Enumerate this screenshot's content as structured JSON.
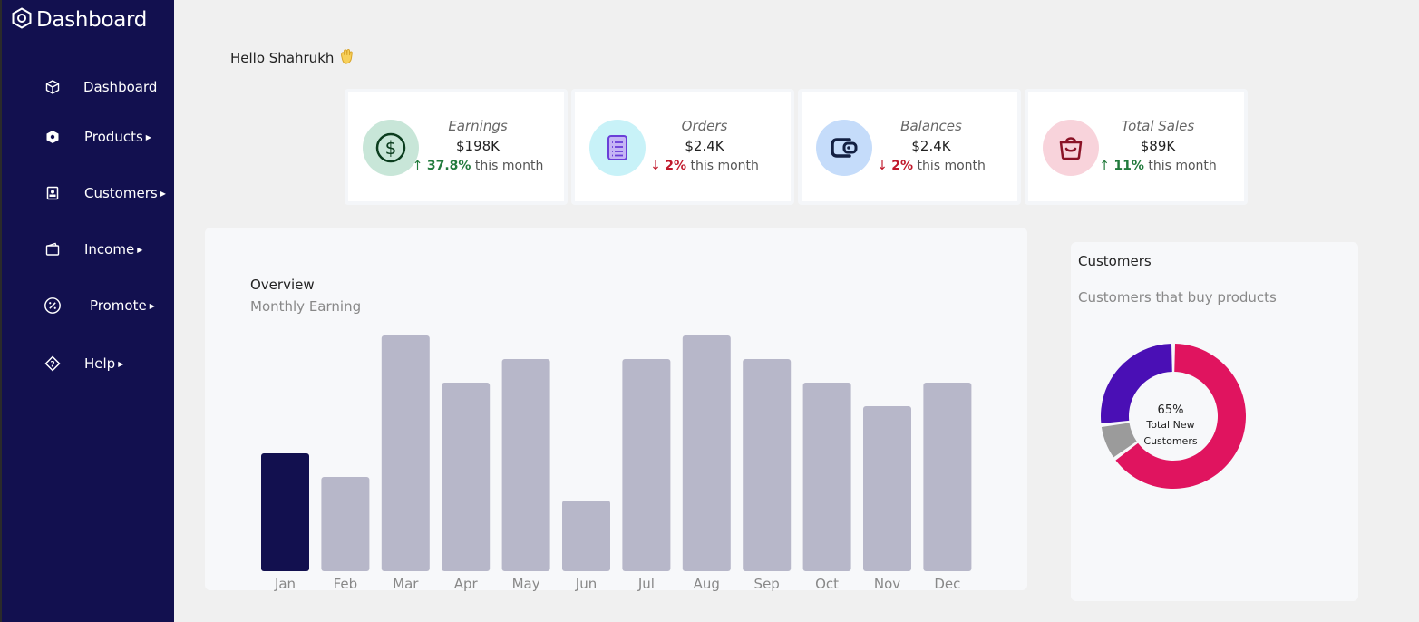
{
  "sidebar": {
    "brand": "Dashboard",
    "items": [
      {
        "label": "Dashboard",
        "icon": "cube-icon",
        "caret": ""
      },
      {
        "label": "Products",
        "icon": "box-icon",
        "caret": "▶"
      },
      {
        "label": "Customers",
        "icon": "id-card-icon",
        "caret": "▶"
      },
      {
        "label": "Income",
        "icon": "wallet-icon",
        "caret": "▶"
      },
      {
        "label": "Promote",
        "icon": "discount-icon",
        "caret": "▶"
      },
      {
        "label": "Help",
        "icon": "help-icon",
        "caret": "▶"
      }
    ]
  },
  "greeting": "Hello Shahrukh",
  "stats": [
    {
      "label": "Earnings",
      "value": "$198K",
      "change": "37.8%",
      "suffix": "this month",
      "direction": "up",
      "icon": "dollar-icon",
      "bg": "#c8e6d8",
      "fg": "#0b3d1e"
    },
    {
      "label": "Orders",
      "value": "$2.4K",
      "change": "2%",
      "suffix": "this month",
      "direction": "down",
      "icon": "document-icon",
      "bg": "#c8f2f8",
      "fg": "#6a3fd8"
    },
    {
      "label": "Balances",
      "value": "$2.4K",
      "change": "2%",
      "suffix": "this month",
      "direction": "down",
      "icon": "wallet-icon",
      "bg": "#c5dcfa",
      "fg": "#132042"
    },
    {
      "label": "Total Sales",
      "value": "$89K",
      "change": "11%",
      "suffix": "this month",
      "direction": "up",
      "icon": "shopping-bag-icon",
      "bg": "#f8d3db",
      "fg": "#8a1226"
    }
  ],
  "overview": {
    "title": "Overview",
    "subtitle": "Monthly Earning"
  },
  "chart_data": {
    "type": "bar",
    "categories": [
      "Jan",
      "Feb",
      "Mar",
      "Apr",
      "May",
      "Jun",
      "Jul",
      "Aug",
      "Sep",
      "Oct",
      "Nov",
      "Dec"
    ],
    "values": [
      5,
      4,
      10,
      8,
      9,
      3,
      9,
      10,
      9,
      8,
      7,
      8
    ],
    "ylim": [
      0,
      10
    ],
    "highlight_index": 0,
    "colors": {
      "highlight": "#12104f",
      "default": "#b7b7c9"
    }
  },
  "customers": {
    "title": "Customers",
    "subtitle": "Customers that buy products",
    "center_value": "65%",
    "center_label_1": "Total New",
    "center_label_2": "Customers",
    "chart_data": {
      "type": "pie",
      "slices": [
        {
          "value": 65,
          "color": "#e0145f"
        },
        {
          "value": 8,
          "color": "#9b9b9b"
        },
        {
          "value": 27,
          "color": "#4a0fb5"
        }
      ]
    }
  }
}
